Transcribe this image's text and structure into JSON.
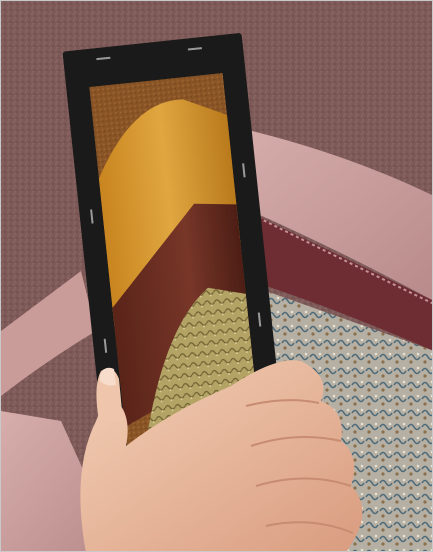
{
  "photo": {
    "alt": "",
    "colors": {
      "carpet": "#7d5a58",
      "sofa": "#c79a98",
      "sofa_piping": "#6e2d33",
      "card": "#1a1a1a",
      "gold_fabric": "#d5962c",
      "brown_fabric": "#6b2e22",
      "tapestry": "#b3a365",
      "hand": "#efc2a6"
    }
  }
}
